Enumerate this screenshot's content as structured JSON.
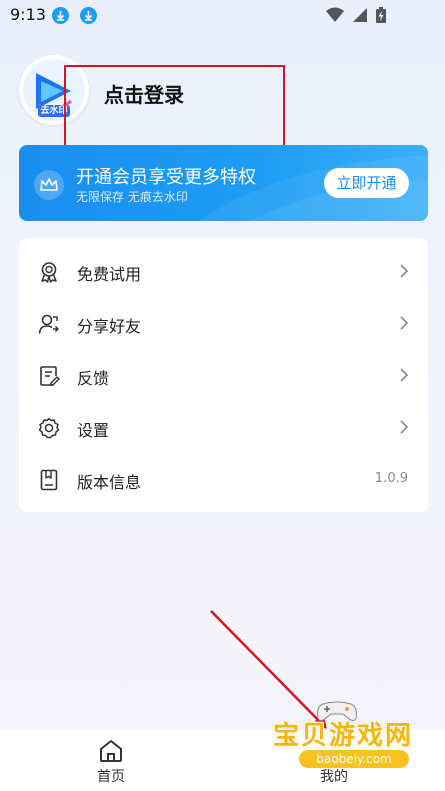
{
  "status_bar": {
    "time": "9:13",
    "icons": [
      "download-icon",
      "download-icon",
      "wifi-icon",
      "signal-icon",
      "battery-charging-icon"
    ]
  },
  "profile": {
    "avatar_text": "去水印",
    "login_label": "点击登录"
  },
  "vip_banner": {
    "title": "开通会员享受更多特权",
    "subtitle": "无限保存 无痕去水印",
    "button_label": "立即开通",
    "icon": "crown-icon"
  },
  "menu": {
    "items": [
      {
        "label": "免费试用",
        "icon": "badge-icon"
      },
      {
        "label": "分享好友",
        "icon": "share-user-icon"
      },
      {
        "label": "反馈",
        "icon": "feedback-icon"
      },
      {
        "label": "设置",
        "icon": "gear-icon"
      },
      {
        "label": "版本信息",
        "icon": "version-icon",
        "value": "1.0.9"
      }
    ]
  },
  "bottom_nav": {
    "home_label": "首页",
    "mine_label": "我的"
  },
  "watermark": {
    "text": "宝贝游戏网",
    "url": "baobeiy.com"
  },
  "colors": {
    "accent": "#1a8ef0",
    "annotation": "#d9141e"
  }
}
